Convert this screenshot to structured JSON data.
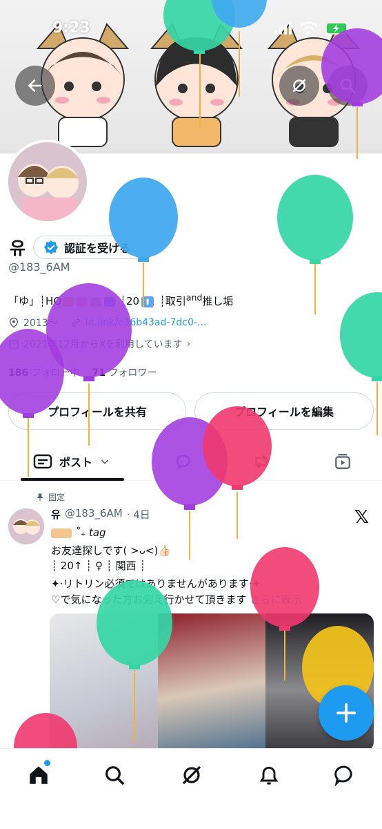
{
  "status": {
    "time": "9:23"
  },
  "profile": {
    "name": "유",
    "verify_label": "認証を受ける",
    "handle": "@183_6AM",
    "bio_parts": {
      "a": "「ゆ」",
      "b": "HQ",
      "c": "20",
      "d": "取引",
      "e": "and",
      "f": "推し垢"
    },
    "location": "2013～",
    "link": "lit.link/e56b43ad-7dc0-...",
    "joined": "2021年12月からXを利用しています",
    "following_count": "186",
    "following_label": "フォロー中",
    "followers_count": "71",
    "followers_label": "フォロワー",
    "share_label": "プロフィールを共有",
    "edit_label": "プロフィールを編集"
  },
  "tabs": {
    "posts_label": "ポスト"
  },
  "post": {
    "pinned_label": "固定",
    "author": "유",
    "handle": "@183_6AM",
    "age": "· 4日",
    "line1": "˚₊ tag",
    "line2": "お友達探しです( >ᴗ<)👍🏻",
    "line3": "┊ 20↑ ┊ ♀ ┊ 関西 ┊",
    "line4": "✦·リトリン必須ではありませんがあります·✦",
    "line5": "♡で気になった方お迎え行かせて頂きます",
    "more_label": "さらに表示"
  },
  "colors": {
    "accent": "#1d9bf0",
    "balloon_green": "#35d6a6",
    "balloon_purple": "#a23be0",
    "balloon_pink": "#f0386e",
    "balloon_blue": "#3ea8ef",
    "balloon_yellow": "#f2c21a"
  },
  "icons": [
    "back-arrow-icon",
    "grok-icon",
    "search-icon",
    "verified-badge-icon",
    "location-icon",
    "link-icon",
    "calendar-icon",
    "chevron-right-icon",
    "posts-tab-icon",
    "chevron-down-icon",
    "reply-icon",
    "repost-icon",
    "media-icon",
    "pin-icon",
    "x-logo-icon",
    "plus-icon",
    "home-icon",
    "explore-icon",
    "grok-nav-icon",
    "bell-icon",
    "messages-icon"
  ]
}
